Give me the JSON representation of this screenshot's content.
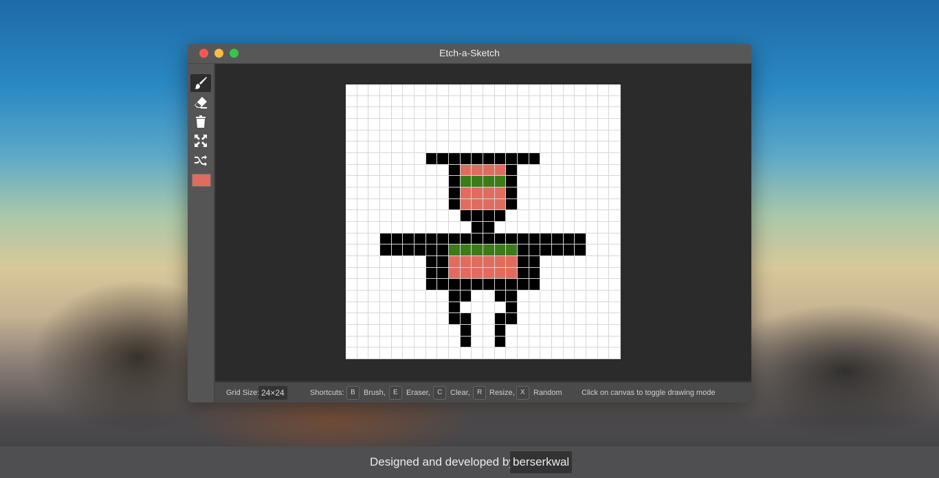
{
  "window": {
    "title": "Etch-a-Sketch"
  },
  "toolbar": {
    "tools": [
      {
        "name": "brush-icon",
        "active": true
      },
      {
        "name": "eraser-icon",
        "active": false
      },
      {
        "name": "trash-icon",
        "active": false
      },
      {
        "name": "resize-icon",
        "active": false
      },
      {
        "name": "random-icon",
        "active": false
      }
    ],
    "current_color": "#e06c5f"
  },
  "canvas": {
    "grid_size": 24,
    "colors": {
      ".": "#ffffff",
      "K": "#000000",
      "S": "#e06c5f",
      "G": "#3b7c19"
    },
    "rows": [
      "........................",
      "........................",
      "........................",
      "........................",
      "........................",
      "........................",
      "....,,,,,,,,,,..........",
      "........................",
      "........................",
      "........................",
      "........................",
      "........................",
      "........................",
      "........................",
      "........................",
      "........................",
      "........................",
      "........................",
      "........................",
      "........................",
      "........................",
      "........................",
      "........................",
      "........................"
    ],
    "pixels": [
      "........................",
      "........................",
      "........................",
      "........................",
      "........................",
      "........................",
      ".......KKKKKKKKKK.......",
      ".........KSSSSK.........",
      ".........KGGGGK.........",
      ".........KSSSSK.........",
      ".........KSSSSK.........",
      "..........KKKK..........",
      "...........KK...........",
      "...KKKKKKKKKKKKKKKKKK...",
      "...KKKKKKGGGGGGKKKKKK...",
      ".......KKSSSSSSKK.......",
      ".......KKSSSSSSKK.......",
      ".......KKKKKKKKKK.......",
      ".........KK..KK.........",
      ".........K....K.........",
      ".........KK..KK.........",
      "..........K..K..........",
      "..........K..K..........",
      "........................"
    ]
  },
  "status": {
    "grid_label": "Grid Size:",
    "grid_value": "24×24",
    "shortcuts_label": "Shortcuts:",
    "shortcuts": [
      {
        "key": "B",
        "label": "Brush,"
      },
      {
        "key": "E",
        "label": "Eraser,"
      },
      {
        "key": "C",
        "label": "Clear,"
      },
      {
        "key": "R",
        "label": "Resize,"
      },
      {
        "key": "X",
        "label": "Random"
      }
    ],
    "hint": "Click on canvas to toggle drawing mode"
  },
  "footer": {
    "text": "Designed and developed by",
    "author": "berserkwal"
  }
}
